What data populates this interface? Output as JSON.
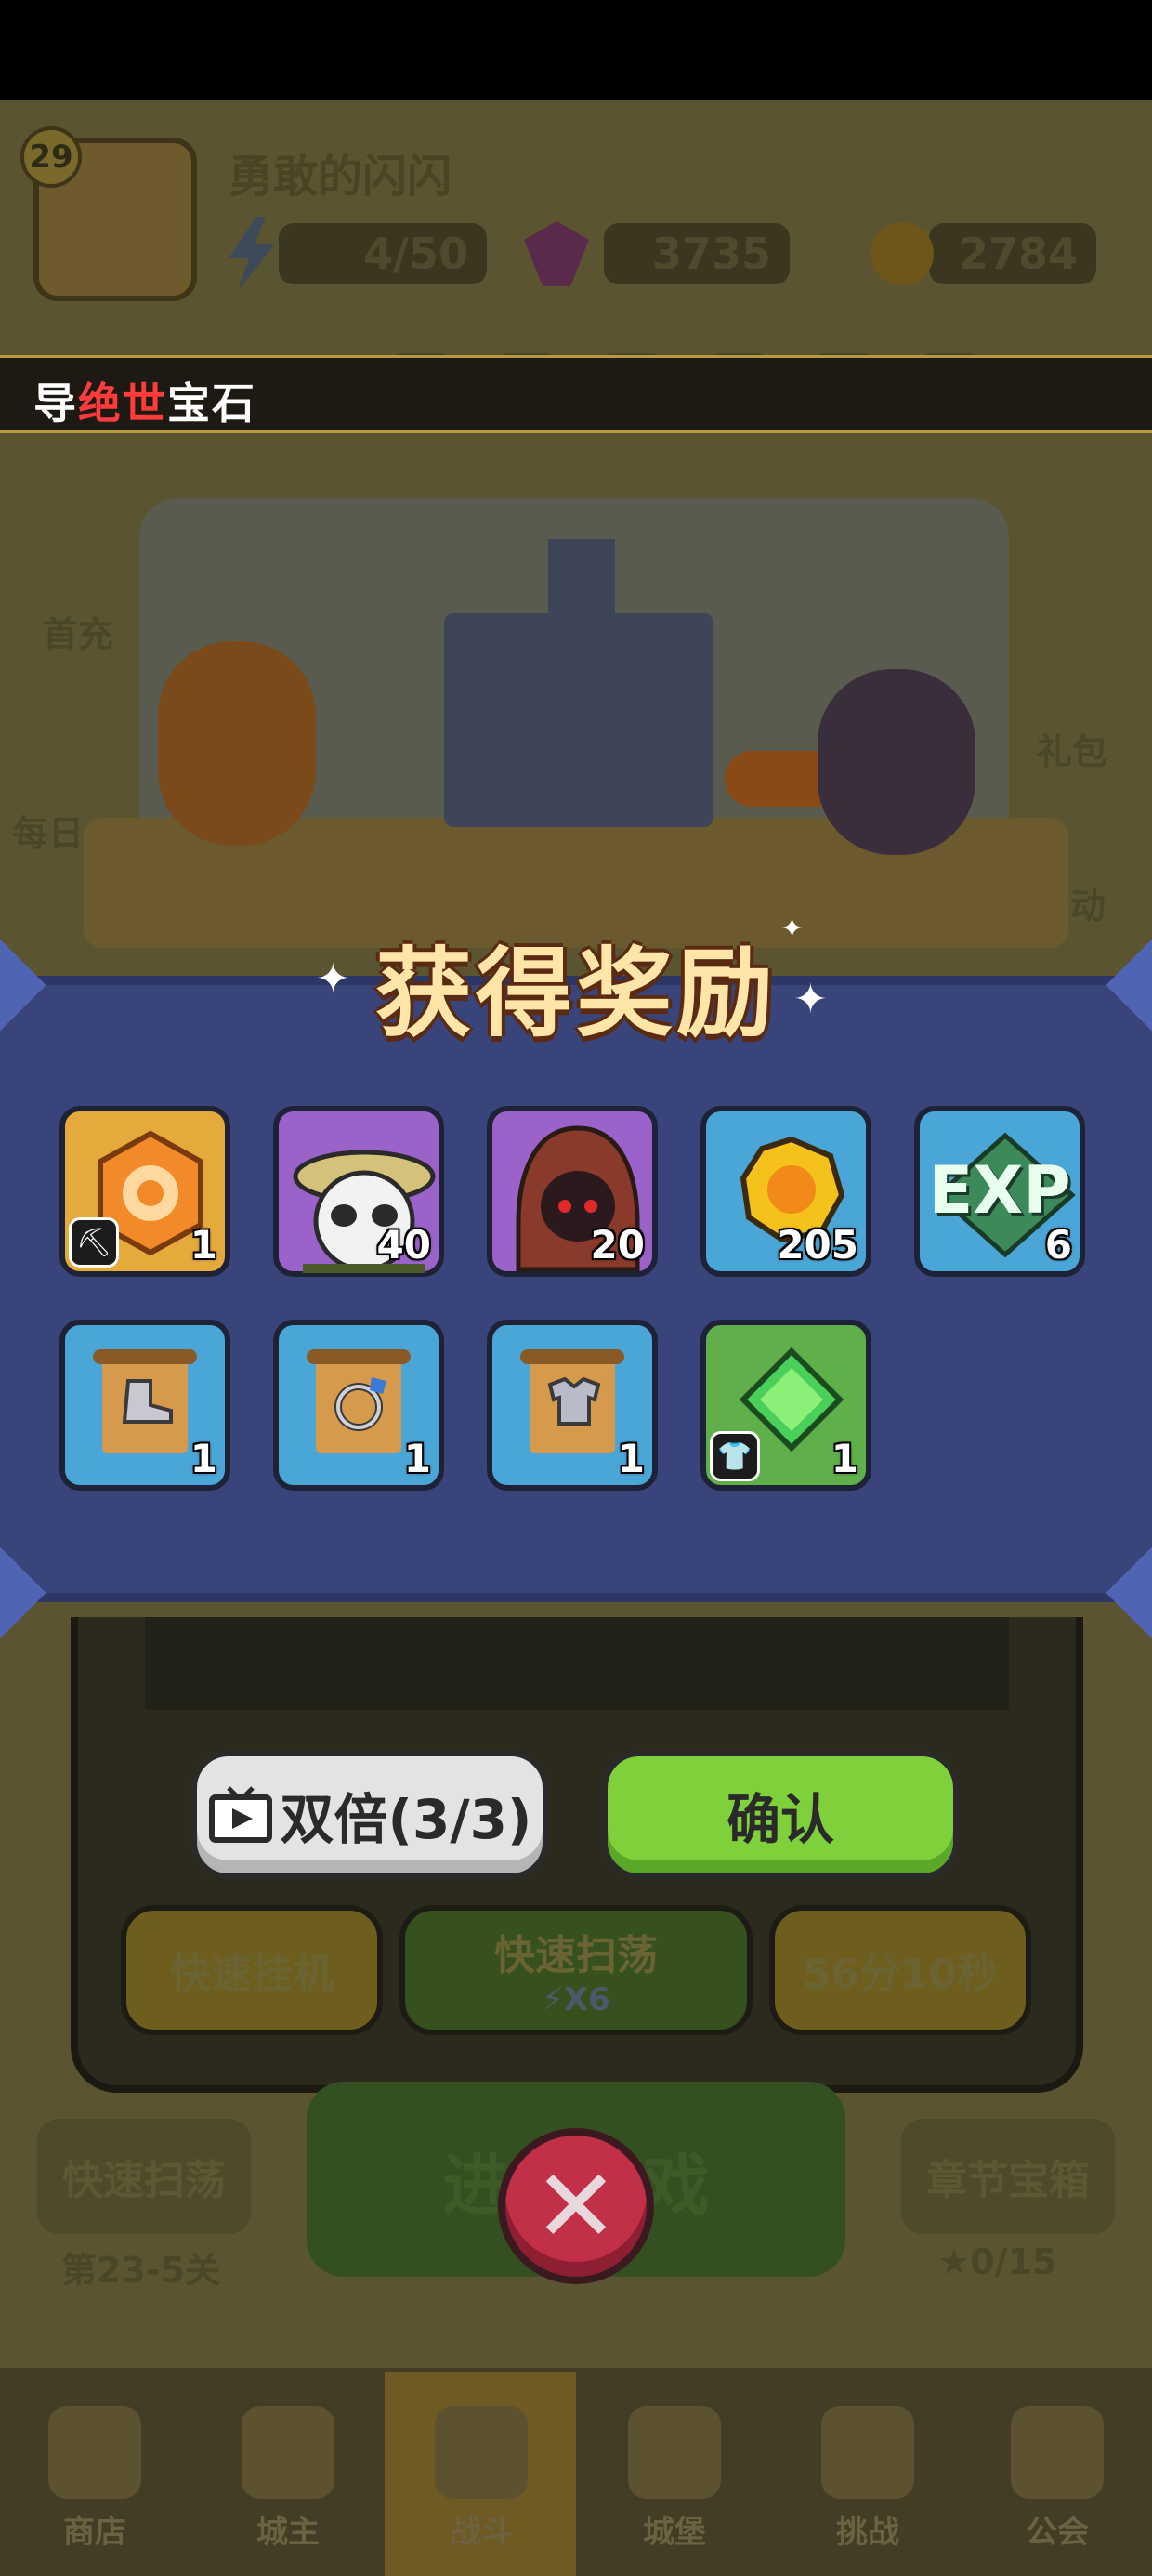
{
  "player": {
    "level": "29",
    "name": "勇敢的闪闪"
  },
  "resources": {
    "energy": "4/50",
    "gems": "3735",
    "coins": "2784"
  },
  "banner": {
    "prefix": "导",
    "highlight": "绝世",
    "suffix": "宝石"
  },
  "side_labels": {
    "first_charge": "首充",
    "daily": "每日",
    "gift": "礼包",
    "activity": "动"
  },
  "reward": {
    "title": "获得奖励",
    "items": [
      {
        "name": "gem-core",
        "icon": "hexagon-gem-icon",
        "qty": "1",
        "tag": "pickaxe-icon",
        "bg": "#e5a93c"
      },
      {
        "name": "panda-hero",
        "icon": "panda-portrait-icon",
        "qty": "40",
        "bg": "#9b63c9"
      },
      {
        "name": "hooded-hero",
        "icon": "hooded-portrait-icon",
        "qty": "20",
        "bg": "#9b63c9"
      },
      {
        "name": "gold-coin",
        "icon": "coin-icon",
        "qty": "205",
        "bg": "#4aa6d6"
      },
      {
        "name": "exp",
        "icon": "exp-icon",
        "label": "EXP",
        "qty": "6",
        "bg": "#4aa6d6"
      },
      {
        "name": "boots-scroll",
        "icon": "boot-scroll-icon",
        "qty": "1",
        "bg": "#4aa6d6"
      },
      {
        "name": "ring-scroll",
        "icon": "ring-scroll-icon",
        "qty": "1",
        "bg": "#4aa6d6"
      },
      {
        "name": "armor-scroll",
        "icon": "armor-scroll-icon",
        "qty": "1",
        "bg": "#4aa6d6"
      },
      {
        "name": "green-gem",
        "icon": "green-gem-icon",
        "qty": "1",
        "tag": "shirt-icon",
        "bg": "#5fb04a"
      }
    ]
  },
  "buttons": {
    "double": "双倍(3/3)",
    "confirm": "确认",
    "fast_idle": "快速挂机",
    "fast_sweep": "快速扫荡",
    "fast_sweep_cost": "X6",
    "timer": "56分10秒",
    "quick_sweep_left": "快速扫荡",
    "stage": "第23-5关",
    "enter_game": "进入游戏",
    "chapter_box": "章节宝箱",
    "stars": "0/15"
  },
  "nav": [
    {
      "label": "商店"
    },
    {
      "label": "城主"
    },
    {
      "label": "战斗"
    },
    {
      "label": "城堡"
    },
    {
      "label": "挑战"
    },
    {
      "label": "公会"
    }
  ],
  "colors": {
    "reward_panel": "#39457a",
    "confirm_green": "#7fd03a",
    "close_red": "#c23048",
    "highlight_red": "#ff3b3b"
  }
}
